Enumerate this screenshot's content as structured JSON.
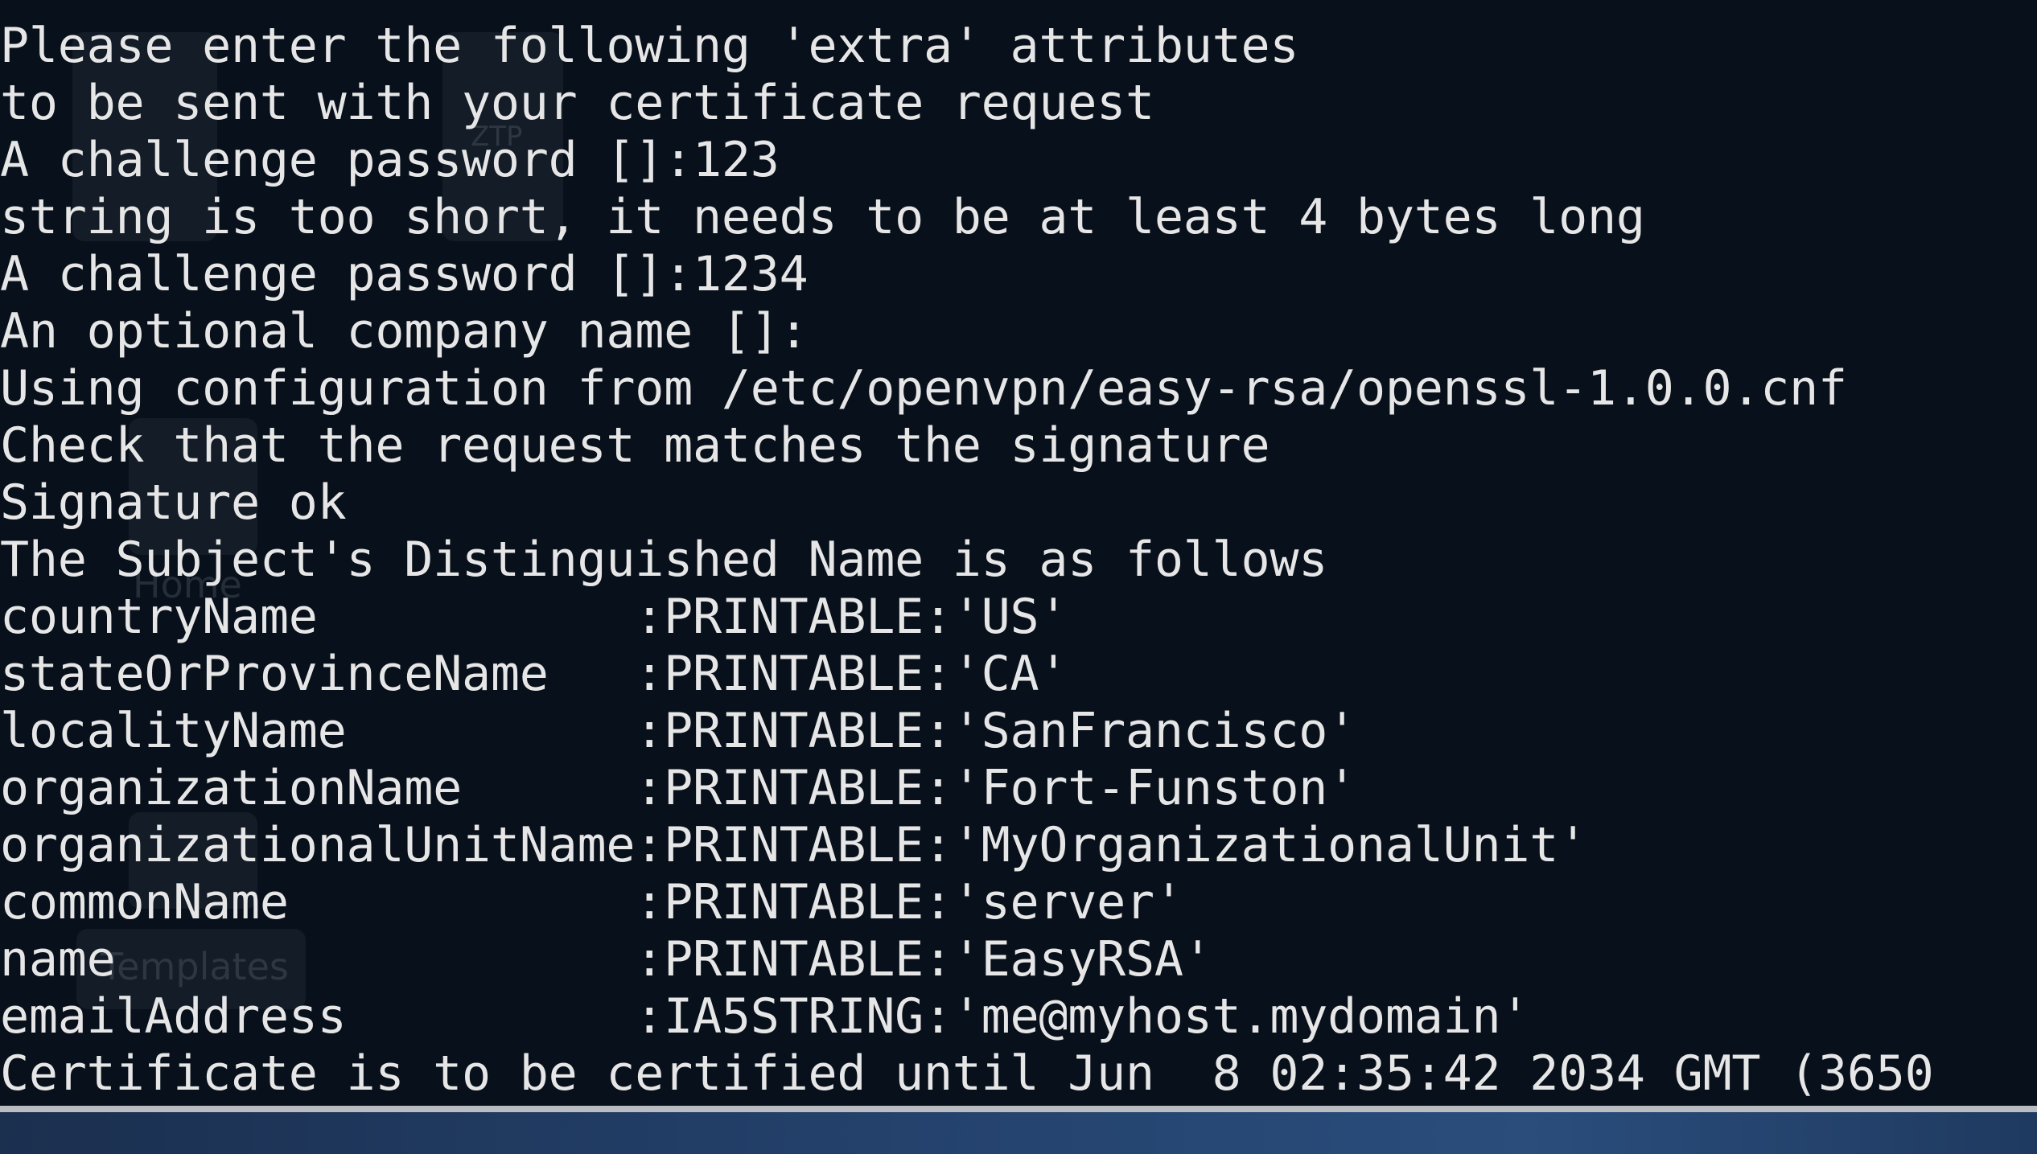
{
  "terminal": {
    "lines": [
      "Please enter the following 'extra' attributes",
      "to be sent with your certificate request",
      "A challenge password []:123",
      "string is too short, it needs to be at least 4 bytes long",
      "A challenge password []:1234",
      "An optional company name []:",
      "Using configuration from /etc/openvpn/easy-rsa/openssl-1.0.0.cnf",
      "Check that the request matches the signature",
      "Signature ok",
      "The Subject's Distinguished Name is as follows",
      "countryName           :PRINTABLE:'US'",
      "stateOrProvinceName   :PRINTABLE:'CA'",
      "localityName          :PRINTABLE:'SanFrancisco'",
      "organizationName      :PRINTABLE:'Fort-Funston'",
      "organizationalUnitName:PRINTABLE:'MyOrganizationalUnit'",
      "commonName            :PRINTABLE:'server'",
      "name                  :PRINTABLE:'EasyRSA'",
      "emailAddress          :IA5STRING:'me@myhost.mydomain'",
      "Certificate is to be certified until Jun  8 02:35:42 2034 GMT (3650"
    ]
  },
  "desktop": {
    "ghost_labels": [
      "ZTP",
      "Home",
      "Templates"
    ]
  },
  "colors": {
    "terminal_bg": "#08101b",
    "terminal_text": "#e6e6e6",
    "taskbar": "#23406a"
  }
}
